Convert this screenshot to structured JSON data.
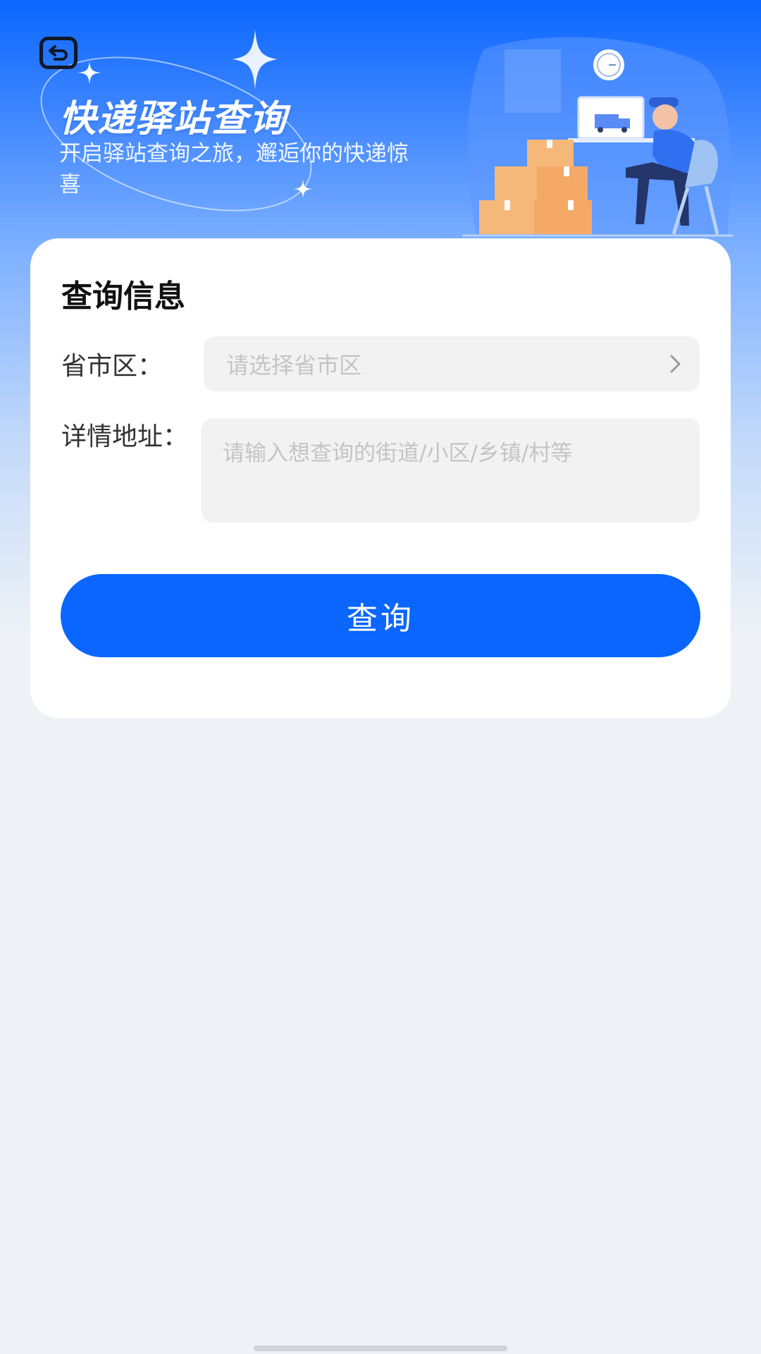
{
  "hero": {
    "title": "快递驿站查询",
    "subtitle": "开启驿站查询之旅，邂逅你的快递惊喜"
  },
  "icons": {
    "back": "back-arrow-icon",
    "chevron": "chevron-right-icon"
  },
  "form": {
    "title": "查询信息",
    "region_label": "省市区：",
    "region_placeholder": "请选择省市区",
    "detail_label": "详情地址：",
    "detail_placeholder": "请输入想查询的街道/小区/乡镇/村等",
    "detail_value": "",
    "submit_label": "查询"
  },
  "colors": {
    "brand": "#0a66ff",
    "background": "#eef2f6",
    "field_bg": "#f2f2f2",
    "placeholder": "#c4c4c4"
  }
}
